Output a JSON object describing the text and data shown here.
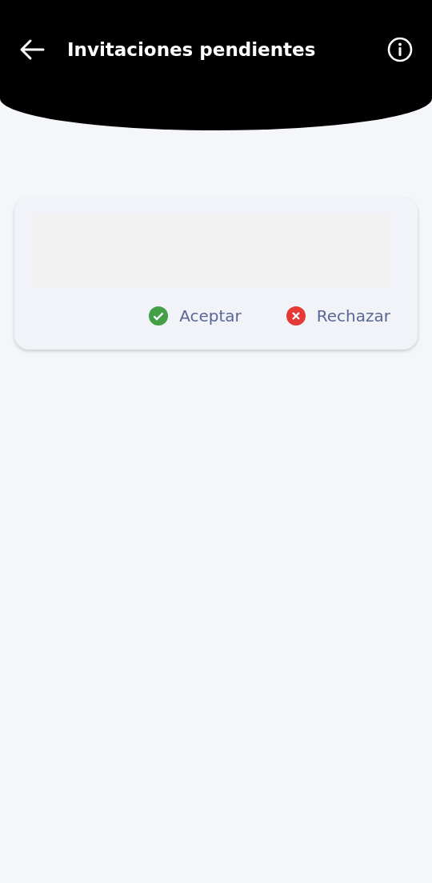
{
  "header": {
    "title": "Invitaciones pendientes"
  },
  "invitations": [
    {
      "content": {
        "kind": "loading"
      },
      "actions": [
        {
          "kind": "accept",
          "label": "Aceptar"
        },
        {
          "kind": "reject",
          "label": "Rechazar"
        }
      ]
    }
  ]
}
